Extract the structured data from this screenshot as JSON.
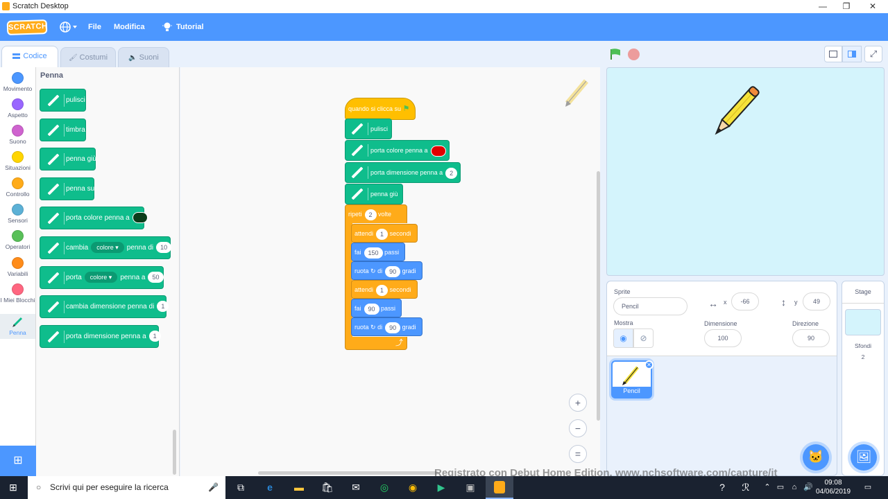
{
  "window": {
    "title": "Scratch Desktop",
    "minimize": "—",
    "maximize": "❐",
    "close": "✕"
  },
  "menubar": {
    "logo": "SCRATCH",
    "file": "File",
    "edit": "Modifica",
    "tutorial": "Tutorial"
  },
  "tabs": {
    "code": "Codice",
    "costumes": "Costumi",
    "sounds": "Suoni"
  },
  "categories": [
    {
      "label": "Movimento",
      "color": "#4c97ff"
    },
    {
      "label": "Aspetto",
      "color": "#9966ff"
    },
    {
      "label": "Suono",
      "color": "#cf63cf"
    },
    {
      "label": "Situazioni",
      "color": "#ffd500"
    },
    {
      "label": "Controllo",
      "color": "#ffab19"
    },
    {
      "label": "Sensori",
      "color": "#5cb1d6"
    },
    {
      "label": "Operatori",
      "color": "#59c059"
    },
    {
      "label": "Variabili",
      "color": "#ff8c1a"
    },
    {
      "label": "I Miei Blocchi",
      "color": "#ff6680"
    },
    {
      "label": "Penna",
      "color": "#0fbd8c"
    }
  ],
  "palette": {
    "heading": "Penna",
    "b1": "pulisci",
    "b2": "timbra",
    "b3": "penna giù",
    "b4": "penna su",
    "b5": "porta colore penna a",
    "b6a": "cambia",
    "b6dd": "colore ▾",
    "b6b": "penna di",
    "b6v": "10",
    "b7a": "porta",
    "b7dd": "colore ▾",
    "b7b": "penna a",
    "b7v": "50",
    "b8": "cambia dimensione penna di",
    "b8v": "1",
    "b9": "porta dimensione penna a",
    "b9v": "1"
  },
  "script": {
    "hat": "quando si clicca su",
    "s1": "pulisci",
    "s2": "porta colore penna a",
    "s3": "porta dimensione penna a",
    "s3v": "2",
    "s4": "penna giù",
    "rep_a": "ripeti",
    "rep_v": "2",
    "rep_b": "volte",
    "w1a": "attendi",
    "w1v": "1",
    "w1b": "secondi",
    "m1a": "fai",
    "m1v": "150",
    "m1b": "passi",
    "r1a": "ruota",
    "r1b": "di",
    "r1v": "90",
    "r1c": "gradi",
    "w2a": "attendi",
    "w2v": "1",
    "w2b": "secondi",
    "m2a": "fai",
    "m2v": "90",
    "m2b": "passi",
    "r2a": "ruota",
    "r2b": "di",
    "r2v": "90",
    "r2c": "gradi"
  },
  "zoom": {
    "in": "+",
    "out": "−",
    "reset": "="
  },
  "sprite_info": {
    "sprite_label": "Sprite",
    "sprite_name": "Pencil",
    "x_label": "x",
    "x_value": "-66",
    "y_label": "y",
    "y_value": "49",
    "show_label": "Mostra",
    "size_label": "Dimensione",
    "size_value": "100",
    "direction_label": "Direzione",
    "direction_value": "90"
  },
  "sprite_tile": {
    "name": "Pencil"
  },
  "stage_pane": {
    "title": "Stage",
    "backdrops_label": "Sfondi",
    "backdrops_count": "2"
  },
  "taskbar": {
    "search_placeholder": "Scrivi qui per eseguire la ricerca",
    "time": "09:08",
    "date": "04/06/2019"
  },
  "watermark": "Registrato con Debut Home Edition. www.nchsoftware.com/capture/it"
}
